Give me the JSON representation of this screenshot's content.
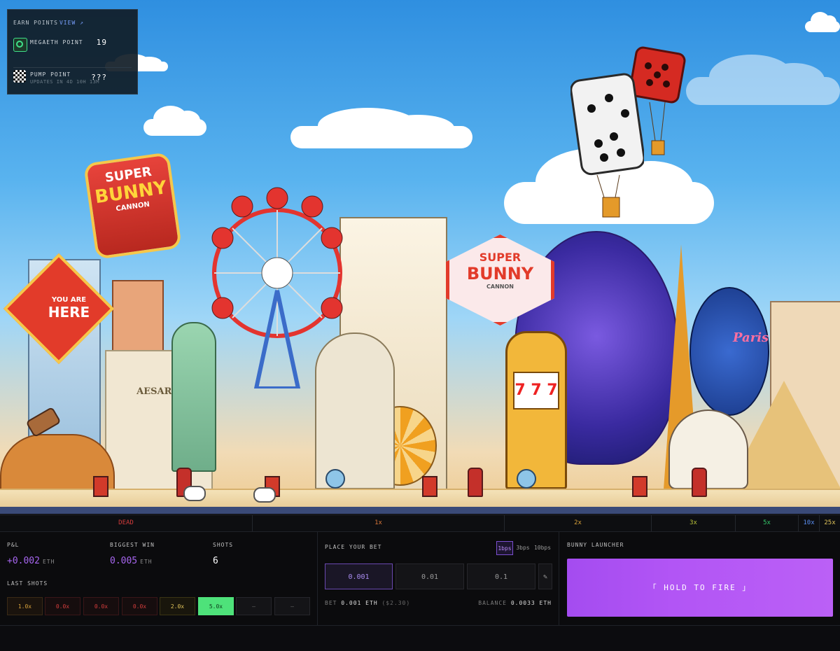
{
  "points": {
    "header": "EARN POINTS",
    "view_link": "VIEW ↗",
    "rows": [
      {
        "name": "MEGAETH POINT",
        "value": "19",
        "icon": "megaeth-logo-icon",
        "sub": ""
      },
      {
        "name": "PUMP POINT",
        "value": "???",
        "icon": "pump-logo-icon",
        "sub": "UPDATES IN 4D 10H 13M"
      }
    ]
  },
  "scene": {
    "signs": {
      "super_bunny_left": [
        "SUPER",
        "BUNNY",
        "CANNON"
      ],
      "you_are_here": [
        "YOU ARE",
        "HERE"
      ],
      "super_bunny_center": [
        "SUPER",
        "BUNNY",
        "CANNON"
      ],
      "caesars": "AESAR'S",
      "paris": "Paris"
    }
  },
  "multipliers": [
    {
      "label": "DEAD",
      "color": "#d33c3c"
    },
    {
      "label": "1x",
      "color": "#d9773a"
    },
    {
      "label": "2x",
      "color": "#d6a03a"
    },
    {
      "label": "3x",
      "color": "#b9c23a"
    },
    {
      "label": "5x",
      "color": "#35c76a"
    },
    {
      "label": "10x",
      "color": "#5a8ef0"
    },
    {
      "label": "25x",
      "color": "#e0c35a"
    }
  ],
  "stats": {
    "pnl_label": "P&L",
    "pnl_value": "+0.002",
    "pnl_unit": "ETH",
    "biggest_win_label": "BIGGEST WIN",
    "biggest_win_value": "0.005",
    "biggest_win_unit": "ETH",
    "shots_label": "SHOTS",
    "shots_value": "6",
    "last_shots_label": "LAST SHOTS",
    "last_shots": [
      {
        "text": "1.0x",
        "color": "#d6a03a",
        "bg": "#1a130d",
        "border": "#3a2a16"
      },
      {
        "text": "0.0x",
        "color": "#d33c3c",
        "bg": "#160d0e",
        "border": "#3a1618"
      },
      {
        "text": "0.0x",
        "color": "#d33c3c",
        "bg": "#160d0e",
        "border": "#3a1618"
      },
      {
        "text": "0.0x",
        "color": "#d33c3c",
        "bg": "#160d0e",
        "border": "#3a1618"
      },
      {
        "text": "2.0x",
        "color": "#e0c35a",
        "bg": "#19160c",
        "border": "#3b3414"
      },
      {
        "text": "5.0x",
        "color": "#0c3a1b",
        "bg": "#4ee27a",
        "border": "#4ee27a"
      },
      {
        "text": "–",
        "color": "#6b6b6b",
        "bg": "#141417",
        "border": "#26262b"
      },
      {
        "text": "–",
        "color": "#6b6b6b",
        "bg": "#141417",
        "border": "#26262b"
      }
    ]
  },
  "bet": {
    "title": "PLACE YOUR BET",
    "speeds": [
      "1bps",
      "3bps",
      "10bps"
    ],
    "selected_speed": "1bps",
    "amounts": [
      "0.001",
      "0.01",
      "0.1"
    ],
    "selected_amount": "0.001",
    "edit_icon": "pencil-icon",
    "bet_label": "BET",
    "bet_value": "0.001 ETH",
    "bet_usd": "($2.30)",
    "balance_label": "BALANCE",
    "balance_value": "0.0033 ETH"
  },
  "launcher": {
    "title": "BUNNY LAUNCHER",
    "fire_label": "「 HOLD TO FIRE 」",
    "accent": "#b255f5"
  }
}
